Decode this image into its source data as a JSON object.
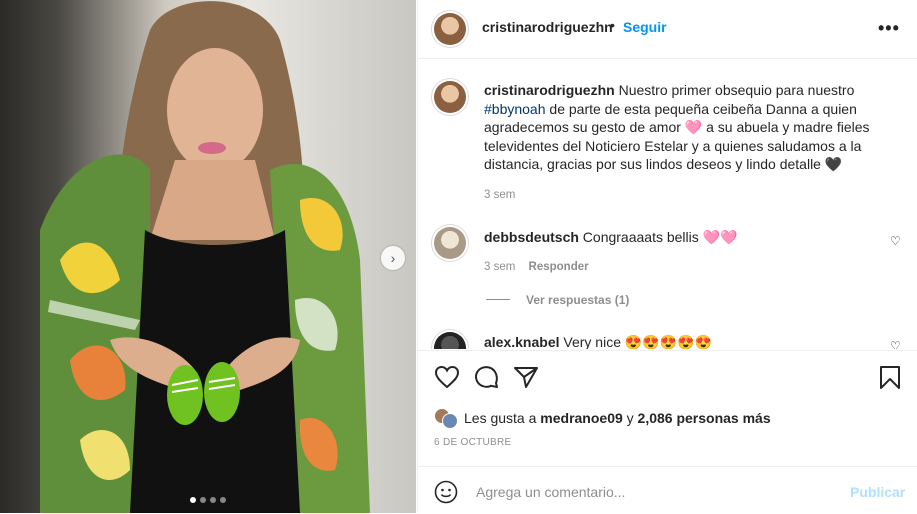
{
  "post": {
    "photo_alt": "",
    "carousel_next": "›",
    "slide_count": 4,
    "active_slide": 1
  },
  "header": {
    "username": "cristinarodriguezhn",
    "separator": "•",
    "follow_label": "Seguir",
    "more_label": "•••"
  },
  "caption": {
    "username": "cristinarodriguezhn",
    "text_before": "Nuestro primer obsequio para nuestro",
    "hashtag": "#bbynoah",
    "text_after": "de parte de esta pequeña ceibeña Danna a quien agradecemos su gesto de amor 🩷 a su abuela y madre fieles televidentes del Noticiero Estelar y a quienes saludamos a la distancia, gracias por sus lindos deseos y lindo detalle 🖤",
    "time": "3 sem"
  },
  "comments": [
    {
      "username": "debbsdeutsch",
      "text": "Congraaaats bellis 🩷🩷",
      "time": "3 sem",
      "reply_label": "Responder",
      "view_replies": "Ver respuestas (1)"
    },
    {
      "username": "alex.knabel",
      "text": "Very nice 😍😍😍😍😍"
    }
  ],
  "likes": {
    "prefix": "Les gusta a",
    "user": "medranoe09",
    "connector": "y",
    "count": "2,086 personas más"
  },
  "date": "6 DE OCTUBRE",
  "composer": {
    "placeholder": "Agrega un comentario...",
    "post_label": "Publicar"
  },
  "colors": {
    "link_blue": "#0095f6",
    "hashtag": "#00376b",
    "muted": "#8e8e8e",
    "publish_disabled": "#b2dffc"
  }
}
